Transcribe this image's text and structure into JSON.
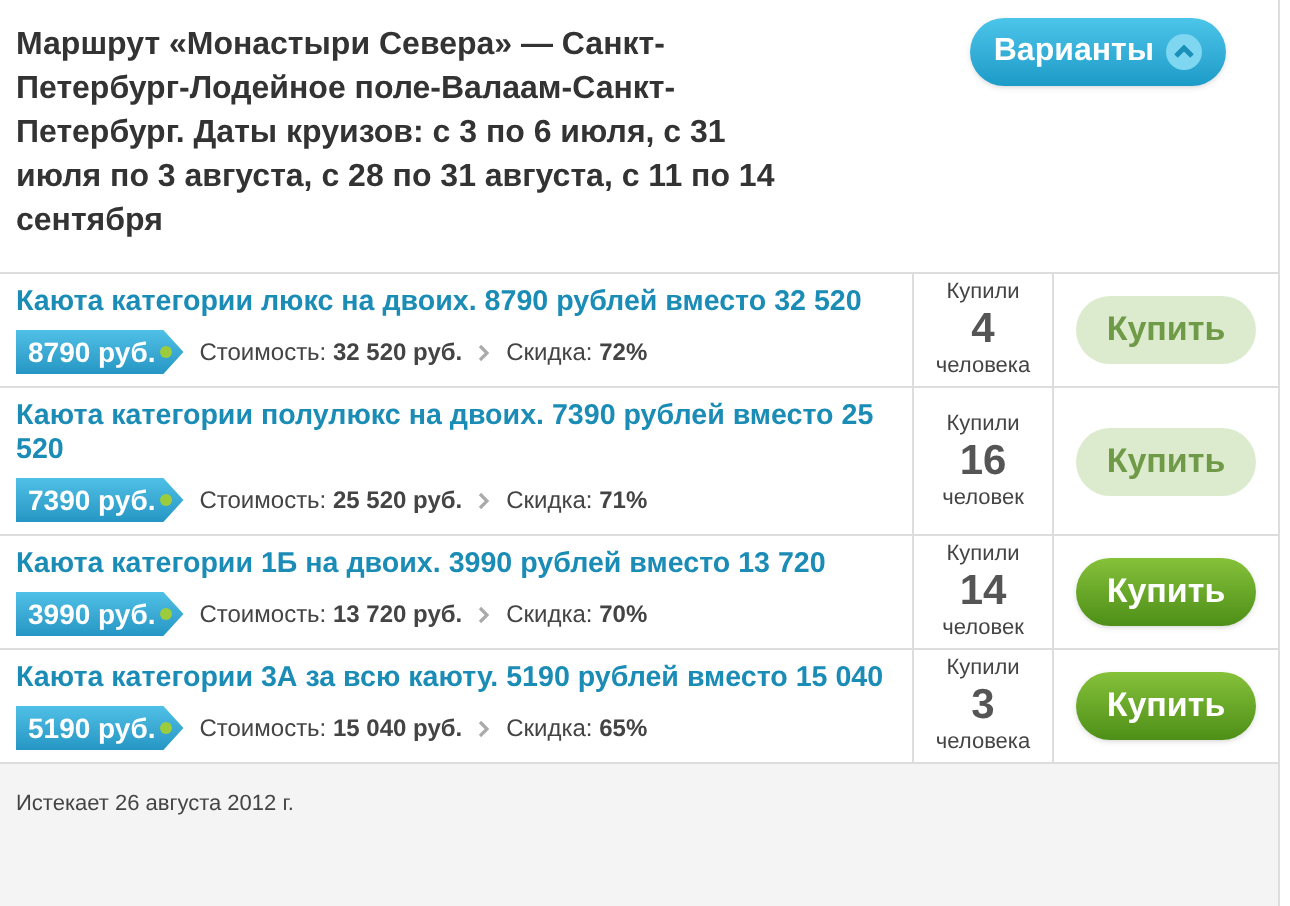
{
  "header": {
    "title": "Маршрут «Монастыри Севера» — Санкт-Петербург-Лодейное поле-Валаам-Санкт-Петербург. Даты круизов: с 3 по 6 июля, с 31 июля по 3 августа, с 28 по 31 августа, с 11 по 14 сентября",
    "variants_button": {
      "label": "Варианты",
      "expanded": true
    }
  },
  "offers": [
    {
      "title": "Каюта категории люкс на двоих. 8790 рублей вместо 32 520",
      "price": "8790 руб.",
      "cost": "Стоимость: **32 520 руб.**",
      "discount": "Скидка: **72%**",
      "bought_label": "Купили",
      "bought_count": "4",
      "bought_unit": "человека",
      "button": "Купить",
      "disabled": true
    },
    {
      "title": "Каюта категории полулюкс на двоих. 7390 рублей вместо 25 520",
      "price": "7390 руб.",
      "cost": "Стоимость: **25 520 руб.**",
      "discount": "Скидка: **71%**",
      "bought_label": "Купили",
      "bought_count": "16",
      "bought_unit": "человек",
      "button": "Купить",
      "disabled": true
    },
    {
      "title": "Каюта категории 1Б на двоих. 3990 рублей вместо 13 720",
      "price": "3990 руб.",
      "cost": "Стоимость: **13 720 руб.**",
      "discount": "Скидка: **70%**",
      "bought_label": "Купили",
      "bought_count": "14",
      "bought_unit": "человек",
      "button": "Купить",
      "disabled": false
    },
    {
      "title": "Каюта категории 3А за всю каюту. 5190 рублей вместо 15 040",
      "price": "5190 руб.",
      "cost": "Стоимость: **15 040 руб.**",
      "discount": "Скидка: **65%**",
      "bought_label": "Купили",
      "bought_count": "3",
      "bought_unit": "человека",
      "button": "Купить",
      "disabled": false
    }
  ],
  "footer": "Истекает 26 августа 2012 г."
}
